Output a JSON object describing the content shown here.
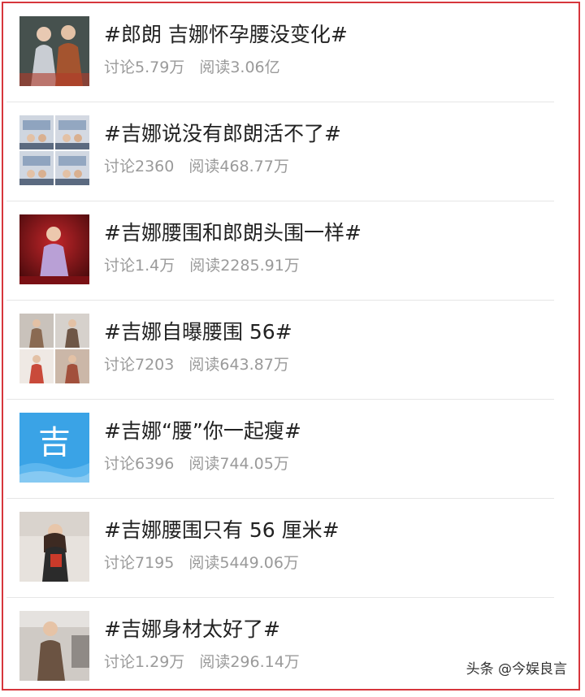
{
  "topics": [
    {
      "title": "#郎朗 吉娜怀孕腰没变化#",
      "discuss": "讨论5.79万",
      "reads": "阅读3.06亿",
      "thumb": "photo-couple"
    },
    {
      "title": "#吉娜说没有郎朗活不了#",
      "discuss": "讨论2360",
      "reads": "阅读468.77万",
      "thumb": "photo-grid-tv"
    },
    {
      "title": "#吉娜腰围和郎朗头围一样#",
      "discuss": "讨论1.4万",
      "reads": "阅读2285.91万",
      "thumb": "photo-stage"
    },
    {
      "title": "#吉娜自曝腰围 56#",
      "discuss": "讨论7203",
      "reads": "阅读643.87万",
      "thumb": "photo-grid-4"
    },
    {
      "title": "#吉娜“腰”你一起瘦#",
      "discuss": "讨论6396",
      "reads": "阅读744.05万",
      "thumb": "ji-logo",
      "logo_char": "吉"
    },
    {
      "title": "#吉娜腰围只有 56 厘米#",
      "discuss": "讨论7195",
      "reads": "阅读5449.06万",
      "thumb": "photo-woman-red"
    },
    {
      "title": "#吉娜身材太好了#",
      "discuss": "讨论1.29万",
      "reads": "阅读296.14万",
      "thumb": "photo-woman-office"
    }
  ],
  "watermark": "头条 @今娱良言",
  "colors": {
    "frame": "#d6363c",
    "title": "#222222",
    "meta": "#9a9a9a",
    "logo_blue": "#3aa3e6"
  }
}
